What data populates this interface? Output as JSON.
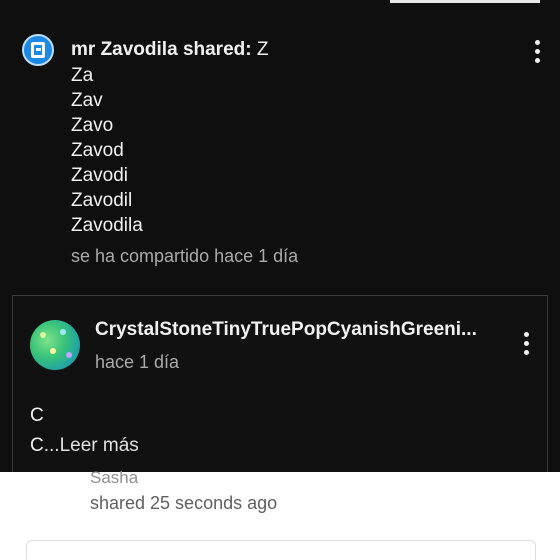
{
  "post": {
    "author": "mr Zavodila",
    "shared_label": "shared:",
    "first_line": "Z",
    "lines": [
      "Za",
      "Zav",
      "Zavo",
      "Zavod",
      "Zavodi",
      "Zavodil",
      "Zavodila"
    ],
    "timestamp": "se ha compartido hace 1 día",
    "avatar_icon": "app-logo-icon"
  },
  "card": {
    "channel_name": "CrystalStoneTinyTruePopCyanishGreeni...",
    "timestamp": "hace 1 día",
    "body_line1": "C",
    "body_line2": "C",
    "read_more": "...Leer más"
  },
  "below": {
    "cut_name": "Sasha",
    "timestamp": "shared 25 seconds ago"
  },
  "colors": {
    "background": "#0f0f0f",
    "text_primary": "#f1f1f1",
    "text_secondary": "#aaaaaa",
    "card_border": "#3a3a3a"
  }
}
